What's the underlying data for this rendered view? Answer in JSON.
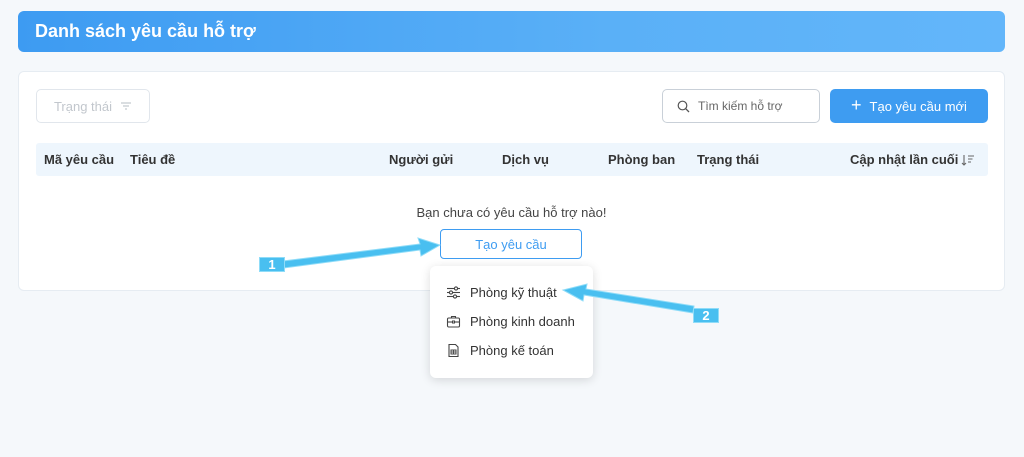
{
  "header": {
    "title": "Danh sách yêu cầu hỗ trợ"
  },
  "toolbar": {
    "status_filter_label": "Trạng thái",
    "search_placeholder": "Tìm kiếm hỗ trợ",
    "new_request_label": "Tạo yêu cầu mới"
  },
  "table": {
    "columns": [
      "Mã yêu cầu",
      "Tiêu đề",
      "Người gửi",
      "Dịch vụ",
      "Phòng ban",
      "Trạng thái",
      "Cập nhật lần cuối"
    ]
  },
  "empty_state": {
    "message": "Bạn chưa có yêu cầu hỗ trợ nào!",
    "create_label": "Tạo yêu cầu"
  },
  "dropdown": {
    "items": [
      {
        "label": "Phòng kỹ thuật",
        "icon": "sliders-icon"
      },
      {
        "label": "Phòng kinh doanh",
        "icon": "briefcase-icon"
      },
      {
        "label": "Phòng kế toán",
        "icon": "document-icon"
      }
    ]
  },
  "annotations": {
    "callout_1": "1",
    "callout_2": "2"
  },
  "colors": {
    "primary": "#3e9cf1",
    "callout": "#49bff0"
  }
}
